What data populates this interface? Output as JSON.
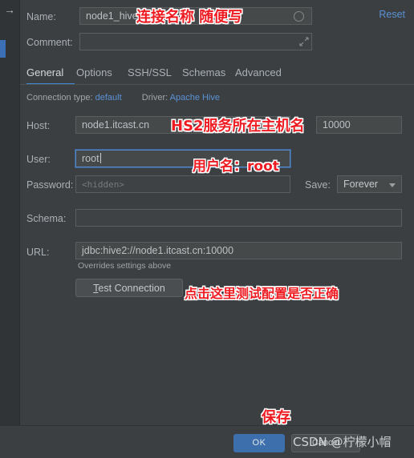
{
  "window": {
    "left_strip": {
      "arrow_icon": "→"
    }
  },
  "header": {
    "name_label": "Name:",
    "name_value": "node1_hive",
    "name_status_icon": "circle-icon",
    "comment_label": "Comment:",
    "comment_value": "",
    "comment_expand_icon": "expand-icon",
    "reset_label": "Reset"
  },
  "tabs": [
    {
      "label": "General",
      "active": true
    },
    {
      "label": "Options",
      "active": false
    },
    {
      "label": "SSH/SSL",
      "active": false
    },
    {
      "label": "Schemas",
      "active": false
    },
    {
      "label": "Advanced",
      "active": false
    }
  ],
  "meta": {
    "connection_type_label": "Connection type:",
    "connection_type_value": "default",
    "driver_label": "Driver:",
    "driver_value": "Apache Hive"
  },
  "form": {
    "host_label": "Host:",
    "host_value": "node1.itcast.cn",
    "port_value": "10000",
    "user_label": "User:",
    "user_value": "root",
    "password_label": "Password:",
    "password_placeholder": "<hidden>",
    "save_label": "Save:",
    "save_value": "Forever",
    "schema_label": "Schema:",
    "schema_value": "",
    "url_label": "URL:",
    "url_value": "jdbc:hive2://node1.itcast.cn:10000",
    "url_hint": "Overrides settings above",
    "test_connection_prefix": "T",
    "test_connection_rest": "est Connection"
  },
  "footer": {
    "ok_label": "OK",
    "cancel_label": "Cancel"
  },
  "annotations": [
    {
      "text": "连接名称 随便写",
      "note": "name-field-annotation"
    },
    {
      "text": "HS2服务所在主机名",
      "note": "host-field-annotation"
    },
    {
      "text": "用户名：root",
      "note": "user-field-annotation"
    },
    {
      "text": "点击这里测试配置是否正确",
      "note": "test-connection-annotation"
    },
    {
      "text": "保存",
      "note": "ok-button-annotation"
    }
  ],
  "watermark": {
    "text": "CSDN @柠檬小帽"
  },
  "colors": {
    "background": "#3c3f41",
    "field_bg": "#45494a",
    "accent_blue": "#3f8bd6",
    "link_blue": "#5a92d6",
    "ok_button": "#3c6fab",
    "annotation_red": "#ee1c22",
    "focus_border": "#5788c7"
  }
}
